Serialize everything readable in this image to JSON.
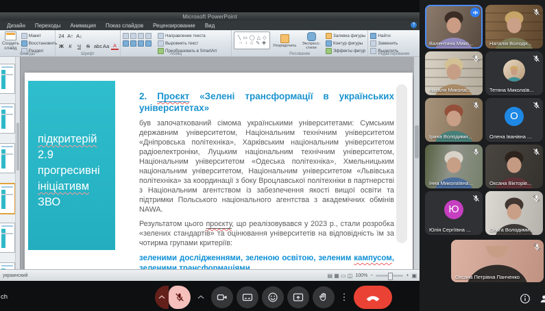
{
  "powerpoint": {
    "title": "Microsoft PowerPoint",
    "tabs": [
      "Дизайн",
      "Переходы",
      "Анимация",
      "Показ слайдов",
      "Рецензирование",
      "Вид"
    ],
    "ribbon": {
      "slides": {
        "label": "Слайды",
        "new_slide": "Создать слайд",
        "layout": "Макет",
        "reset": "Восстановить",
        "section": "Раздел"
      },
      "font": {
        "label": "Шрифт",
        "row1": [
          "24",
          "А↑",
          "А↓"
        ],
        "row2": [
          "Ж",
          "К",
          "Ч",
          "S",
          "abc",
          "Аа",
          "А"
        ]
      },
      "paragraph": {
        "label": "Абзац",
        "text_direction": "Направление текста",
        "align_text": "Выровнять текст",
        "smartart": "Преобразовать в SmartArt"
      },
      "drawing": {
        "label": "Рисование",
        "arrange": "Упорядочить",
        "quick_styles": "Экспресс-стили",
        "shape_fill": "Заливка фигуры",
        "shape_outline": "Контур фигуры",
        "shape_effects": "Эффекты фигур",
        "shape_glyphs": [
          [
            "╲",
            "▭",
            "◯",
            "△",
            "◇"
          ],
          [
            "→",
            "↓",
            "☆",
            "✎",
            "✚"
          ]
        ]
      },
      "editing": {
        "label": "Редактирование",
        "find": "Найти",
        "replace": "Заменить",
        "select": "Выделить"
      }
    },
    "thumbnails": {
      "count": 6,
      "selected_index": 3
    },
    "status_bar": {
      "language": "украинский",
      "zoom": "100%",
      "view_icons": [
        "▤",
        "▦",
        "▭",
        "◫"
      ],
      "minus": "−",
      "plus": "+"
    },
    "slide": {
      "box": {
        "color": "#27b6c6",
        "lines": [
          {
            "text": "підкритерій",
            "misspelled": true
          },
          {
            "text": "2.9",
            "misspelled": false
          },
          {
            "text": "прогресивні",
            "misspelled": false
          },
          {
            "text": "ініціативм",
            "misspelled": true
          },
          {
            "text": "ЗВО",
            "misspelled": false
          }
        ]
      },
      "heading": {
        "number": "2.",
        "linked_word": "Проєкт",
        "rest": "«Зелені трансформації в українських університетах»",
        "color": "#1993cf"
      },
      "paragraph1": "був започаткований сімома українськими університетами: Сумським державним університетом, Національним технічним університетом «Дніпровська політехніка», Харківським національним університетом радіоелектроніки, Луцьким національним технічним університетом, Національним університетом «Одеська політехніка», Хмельницьким національним університетом, Національним університетом «Львівська політехніка» за координації з боку Вроцлавської політехніки в партнерстві з Національним агентством із забезпечення якості вищої освіти та підтримки Польського національного агентства з академічних обмінів NAWA.",
      "paragraph2_before": "Результатом цього ",
      "paragraph2_word": "проєкту",
      "paragraph2_after": ", що реалізовувався у 2023 р., стали розробка «зелених стандартів» та оцінювання університетів на відповідність їм за чотирма групами критеріїв:",
      "highlight_before": "зеленими дослідженнями,  зеленою освітою, зеленим ",
      "highlight_word": "кампусом",
      "highlight_after": ", зеленими трансформаціями.",
      "highlight_color": "#0c8fd6"
    }
  },
  "meet": {
    "code_fragment": "ch",
    "toolbar_icons": [
      "mic-off",
      "camera",
      "captions",
      "reactions",
      "present",
      "raise-hand",
      "more",
      "end-call"
    ],
    "accent_colors": {
      "active_border": "#4e8df6",
      "speaker_badge": "#2f7ff7",
      "mute_pill": "#f5c0bc",
      "end_call": "#ea4335"
    },
    "participants": [
      {
        "name": "Валентина Мико...",
        "status": "speaking",
        "video": true,
        "scene": {
          "bg": "linear-gradient(115deg,#8d7c6e,#57493e)",
          "hair": "#3b2d26",
          "skin": "#c99c83",
          "shirt": "#9188bb"
        }
      },
      {
        "name": "Наталія Володи...",
        "status": "muted",
        "video": true,
        "pattern": "shelves",
        "scene": {
          "bg": "linear-gradient(100deg,#8a6c49,#5e462e)",
          "hair": "#c7a468",
          "skin": "#caa089",
          "shirt": "#7c7a55"
        }
      },
      {
        "name": "Наталя Миколаї...",
        "status": "muted",
        "video": true,
        "pattern": "shelves",
        "scene": {
          "bg": "linear-gradient(100deg,#d9d3c6,#b3ab9c)",
          "hair": "#d3c094",
          "skin": "#c69e86",
          "shirt": "#a98a66"
        }
      },
      {
        "name": "Тетяна Миколаїв...",
        "status": "muted",
        "video": false,
        "avatar": {
          "type": "photo",
          "bg": "linear-gradient(135deg,#e8d9c4,#b89a78)",
          "hair": "#cfa868",
          "skin": "#c79c82",
          "shirt": "#3f9097"
        }
      },
      {
        "name": "Ірина Володими...",
        "status": "muted",
        "video": true,
        "scene": {
          "bg": "linear-gradient(100deg,#a8947b,#7c6a52)",
          "hair": "#94503a",
          "skin": "#c99f87",
          "shirt": "#47807a"
        }
      },
      {
        "name": "Олена Іванівна ...",
        "status": "muted",
        "video": false,
        "avatar": {
          "type": "letter",
          "letter": "О",
          "color": "#1e88e5"
        }
      },
      {
        "name": "Інна Миколаївна...",
        "status": "muted",
        "video": true,
        "scene": {
          "bg": "linear-gradient(100deg,#55603f,#8f948b 45%,#76806a)",
          "hair": "#d8d2c8",
          "skin": "#c79e86",
          "shirt": "#4a6c9c"
        }
      },
      {
        "name": "Оксана Вікторів...",
        "status": "muted",
        "video": true,
        "scene": {
          "bg": "linear-gradient(110deg,#4a4540,#35322e)",
          "hair": "#2c231d",
          "skin": "#c59a83",
          "shirt": "#5e3136"
        }
      },
      {
        "name": "Юлія Сергіївна ...",
        "status": "muted",
        "video": false,
        "avatar": {
          "type": "letter",
          "letter": "Ю",
          "color": "#c53fc0"
        }
      },
      {
        "name": "Ольга Володими...",
        "status": "muted",
        "video": true,
        "scene": {
          "bg": "linear-gradient(100deg,#dcd8d2,#b5b1ab)",
          "hair": "#423731",
          "skin": "#c99f87",
          "shirt": "#3d3a38"
        }
      },
      {
        "name": "Оксана Петрівна Панченко",
        "status": "muted",
        "video": true,
        "large": true,
        "scene": {
          "bg": "linear-gradient(100deg,#dcb2a2,#c09282)",
          "hair": "#45362e",
          "skin": "#c89d85",
          "shirt": "#2f2b29"
        }
      }
    ]
  }
}
